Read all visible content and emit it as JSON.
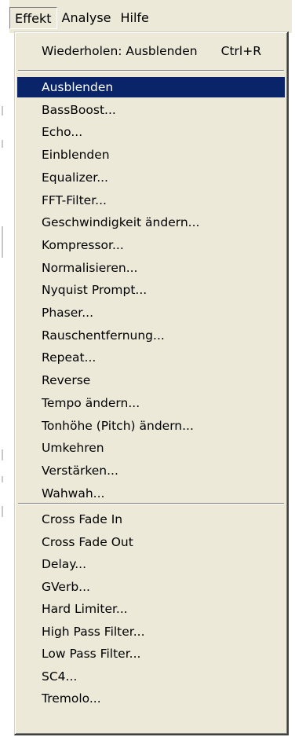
{
  "menubar": {
    "items": [
      {
        "label": "Effekt"
      },
      {
        "label": "Analyse"
      },
      {
        "label": "Hilfe"
      }
    ]
  },
  "menu": {
    "repeat": {
      "label": "Wiederholen: Ausblenden",
      "shortcut": "Ctrl+R"
    },
    "builtin": [
      {
        "label": "Ausblenden"
      },
      {
        "label": "BassBoost..."
      },
      {
        "label": "Echo..."
      },
      {
        "label": "Einblenden"
      },
      {
        "label": "Equalizer..."
      },
      {
        "label": "FFT-Filter..."
      },
      {
        "label": "Geschwindigkeit ändern..."
      },
      {
        "label": "Kompressor..."
      },
      {
        "label": "Normalisieren..."
      },
      {
        "label": "Nyquist Prompt..."
      },
      {
        "label": "Phaser..."
      },
      {
        "label": "Rauschentfernung..."
      },
      {
        "label": "Repeat..."
      },
      {
        "label": "Reverse"
      },
      {
        "label": "Tempo ändern..."
      },
      {
        "label": "Tonhöhe (Pitch) ändern..."
      },
      {
        "label": "Umkehren"
      },
      {
        "label": "Verstärken..."
      },
      {
        "label": "Wahwah..."
      }
    ],
    "plugins": [
      {
        "label": "Cross Fade In"
      },
      {
        "label": "Cross Fade Out"
      },
      {
        "label": "Delay..."
      },
      {
        "label": "GVerb..."
      },
      {
        "label": "Hard Limiter..."
      },
      {
        "label": "High Pass Filter..."
      },
      {
        "label": "Low Pass Filter..."
      },
      {
        "label": "SC4..."
      },
      {
        "label": "Tremolo..."
      }
    ],
    "highlighted": "Ausblenden"
  },
  "colors": {
    "menu_bg": "#ece9d8",
    "highlight_bg": "#0a246a",
    "highlight_fg": "#ffffff"
  }
}
